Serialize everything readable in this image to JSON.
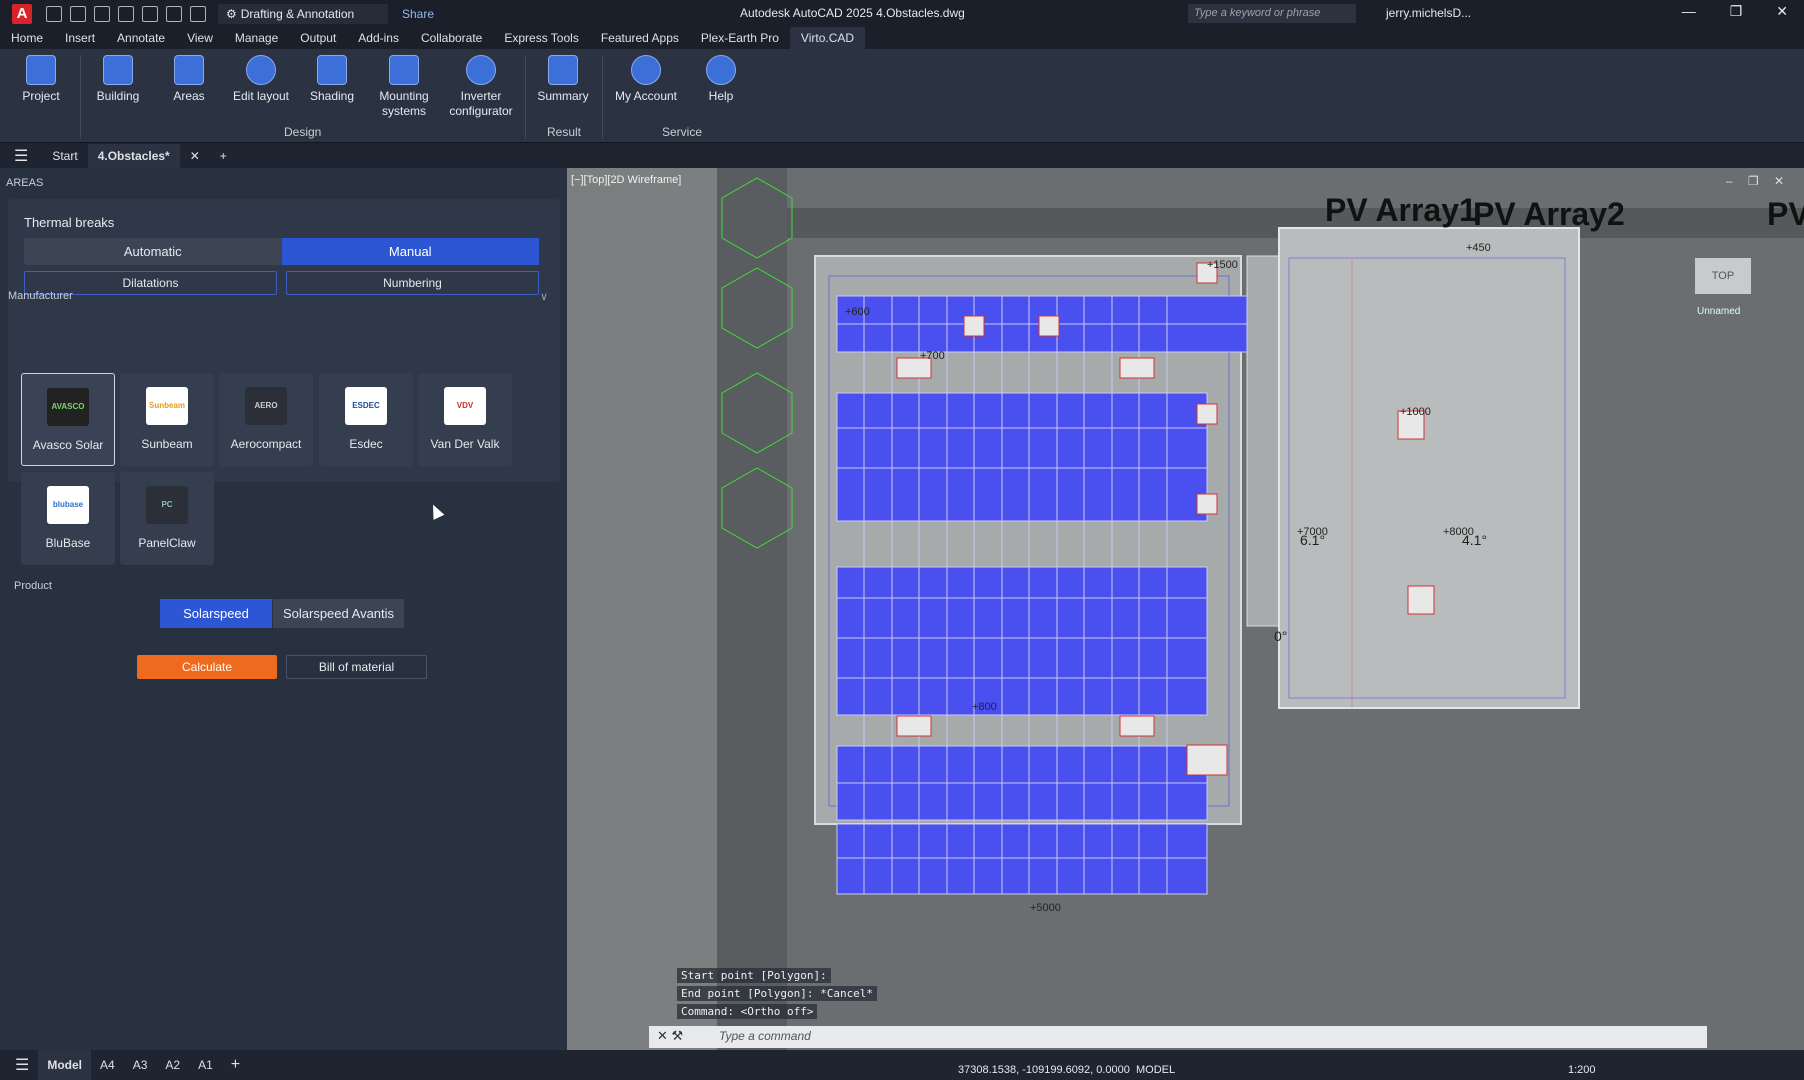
{
  "app": {
    "logo": "A",
    "title": "Autodesk AutoCAD 2025   4.Obstacles.dwg",
    "workspace": "Drafting & Annotation",
    "share": "Share",
    "search_placeholder": "Type a keyword or phrase",
    "user": "jerry.michelsD..."
  },
  "menu_tabs": [
    "Home",
    "Insert",
    "Annotate",
    "View",
    "Manage",
    "Output",
    "Add-ins",
    "Collaborate",
    "Express Tools",
    "Featured Apps",
    "Plex-Earth Pro",
    "Virto.CAD"
  ],
  "ribbon": {
    "buttons": [
      "Project",
      "Building",
      "Areas",
      "Edit layout",
      "Shading",
      "Mounting systems",
      "Inverter configurator",
      "Summary",
      "My Account",
      "Help"
    ],
    "groups": {
      "design": "Design",
      "result": "Result",
      "service": "Service"
    }
  },
  "doc_tabs": {
    "start": "Start",
    "active": "4.Obstacles*",
    "close": "✕",
    "add": "+"
  },
  "panel": {
    "title": "AREAS",
    "thermal_breaks": "Thermal breaks",
    "mode_automatic": "Automatic",
    "mode_manual": "Manual",
    "dilatations": "Dilatations",
    "numbering": "Numbering",
    "manufacturer": "Manufacturer",
    "manufacturers": [
      "Avasco Solar",
      "Sunbeam",
      "Aerocompact",
      "Esdec",
      "Van Der Valk",
      "BluBase",
      "PanelClaw"
    ],
    "product": "Product",
    "product_1": "Solarspeed",
    "product_2": "Solarspeed Avantis",
    "calculate": "Calculate",
    "bill_of_material": "Bill of material"
  },
  "viewport": {
    "label": "[−][Top][2D Wireframe]",
    "array_labels": [
      "PV Array1",
      "PV Array2",
      "PV"
    ],
    "nav_top": "TOP",
    "unnamed": "Unnamed",
    "angles": [
      "6.1°",
      "4.1°",
      "0°"
    ],
    "elevations": [
      "+600",
      "+700",
      "+1500",
      "+1000",
      "+8000",
      "+7000",
      "+5000",
      "+800",
      "+450"
    ],
    "history": [
      "Start point [Polygon]:",
      "End point [Polygon]: *Cancel*",
      "Command:  <Ortho off>"
    ],
    "command_placeholder": "Type a command"
  },
  "layout_tabs": [
    "Model",
    "A4",
    "A3",
    "A2",
    "A1",
    "+"
  ],
  "status": {
    "coords": "37308.1538, -109199.6092, 0.0000",
    "mode": "MODEL",
    "scale": "1:200"
  },
  "colors": {
    "accent": "#2c56d4",
    "calculate": "#ee6a1f",
    "panel": "#283140",
    "pv": "#4a4ff0"
  }
}
